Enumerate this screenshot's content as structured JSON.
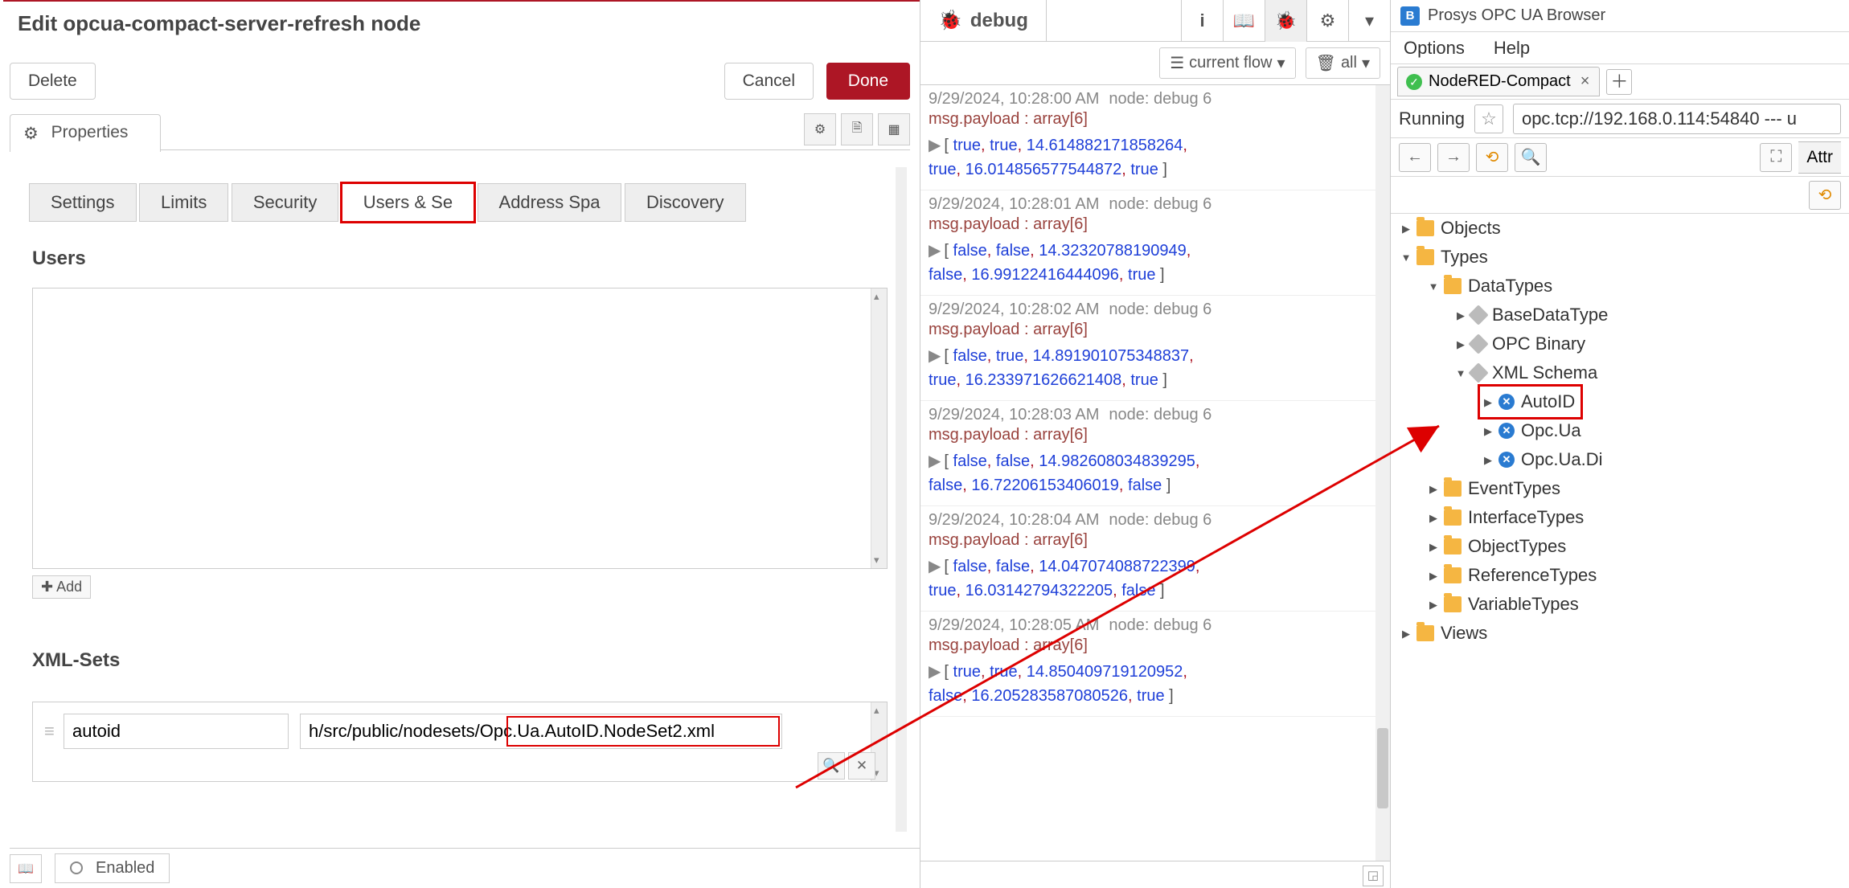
{
  "editor": {
    "title": "Edit opcua-compact-server-refresh node",
    "buttons": {
      "delete": "Delete",
      "cancel": "Cancel",
      "done": "Done"
    },
    "sheet": {
      "label": "Properties",
      "icon_btns": [
        "gear",
        "doc",
        "layout"
      ]
    },
    "tabs": [
      "Settings",
      "Limits",
      "Security",
      "Users & Sets",
      "Address Space",
      "Discovery"
    ],
    "tabs_display": [
      "Settings",
      "Limits",
      "Security",
      "Users & Se",
      "Address Spa",
      "Discovery"
    ],
    "active_tab_index": 3,
    "users": {
      "label": "Users",
      "add": "Add"
    },
    "xmlsets": {
      "label": "XML-Sets",
      "rows": [
        {
          "name": "autoid",
          "path": "h/src/public/nodesets/Opc.Ua.AutoID.NodeSet2.xml",
          "highlight_tail": "Opc.Ua.AutoID.NodeSet2.xml"
        }
      ]
    },
    "footer_enabled": "Enabled"
  },
  "debug": {
    "title": "debug",
    "icons": [
      "info",
      "book",
      "bug",
      "gear",
      "caret"
    ],
    "filter_current": "current flow",
    "filter_all": "all",
    "messages": [
      {
        "ts": "9/29/2024, 10:28:00 AM",
        "node": "node: debug 6",
        "payload": "msg.payload : array[6]",
        "vals": [
          "true",
          "true",
          "14.614882171858264",
          "true",
          "16.014856577544872",
          "true"
        ]
      },
      {
        "ts": "9/29/2024, 10:28:01 AM",
        "node": "node: debug 6",
        "payload": "msg.payload : array[6]",
        "vals": [
          "false",
          "false",
          "14.32320788190949",
          "false",
          "16.99122416444096",
          "true"
        ]
      },
      {
        "ts": "9/29/2024, 10:28:02 AM",
        "node": "node: debug 6",
        "payload": "msg.payload : array[6]",
        "vals": [
          "false",
          "true",
          "14.891901075348837",
          "true",
          "16.233971626621408",
          "true"
        ]
      },
      {
        "ts": "9/29/2024, 10:28:03 AM",
        "node": "node: debug 6",
        "payload": "msg.payload : array[6]",
        "vals": [
          "false",
          "false",
          "14.982608034839295",
          "false",
          "16.72206153406019",
          "false"
        ]
      },
      {
        "ts": "9/29/2024, 10:28:04 AM",
        "node": "node: debug 6",
        "payload": "msg.payload : array[6]",
        "vals": [
          "false",
          "false",
          "14.047074088722399",
          "true",
          "16.03142794322205",
          "false"
        ]
      },
      {
        "ts": "9/29/2024, 10:28:05 AM",
        "node": "node: debug 6",
        "payload": "msg.payload : array[6]",
        "vals": [
          "true",
          "true",
          "14.850409719120952",
          "false",
          "16.205283587080526",
          "true"
        ]
      }
    ]
  },
  "prosys": {
    "title": "Prosys OPC UA Browser",
    "menu": [
      "Options",
      "Help"
    ],
    "tab": "NodeRED-Compact",
    "status": "Running",
    "url": "opc.tcp://192.168.0.114:54840 --- u",
    "attr_tab": "Attr",
    "tree": [
      {
        "d": 0,
        "caret": "closed",
        "icon": "folder",
        "label": "Objects"
      },
      {
        "d": 0,
        "caret": "open",
        "icon": "folder",
        "label": "Types"
      },
      {
        "d": 1,
        "caret": "open",
        "icon": "folder",
        "label": "DataTypes"
      },
      {
        "d": 2,
        "caret": "closed",
        "icon": "box",
        "label": "BaseDataType"
      },
      {
        "d": 2,
        "caret": "closed",
        "icon": "box",
        "label": "OPC Binary"
      },
      {
        "d": 2,
        "caret": "open",
        "icon": "box",
        "label": "XML Schema"
      },
      {
        "d": 3,
        "caret": "closed",
        "icon": "ball",
        "label": "AutoID",
        "redbox": true
      },
      {
        "d": 3,
        "caret": "closed",
        "icon": "ball",
        "label": "Opc.Ua"
      },
      {
        "d": 3,
        "caret": "closed",
        "icon": "ball",
        "label": "Opc.Ua.Di"
      },
      {
        "d": 1,
        "caret": "closed",
        "icon": "folder",
        "label": "EventTypes"
      },
      {
        "d": 1,
        "caret": "closed",
        "icon": "folder",
        "label": "InterfaceTypes"
      },
      {
        "d": 1,
        "caret": "closed",
        "icon": "folder",
        "label": "ObjectTypes"
      },
      {
        "d": 1,
        "caret": "closed",
        "icon": "folder",
        "label": "ReferenceTypes"
      },
      {
        "d": 1,
        "caret": "closed",
        "icon": "folder",
        "label": "VariableTypes"
      },
      {
        "d": 0,
        "caret": "closed",
        "icon": "folder",
        "label": "Views"
      }
    ]
  }
}
